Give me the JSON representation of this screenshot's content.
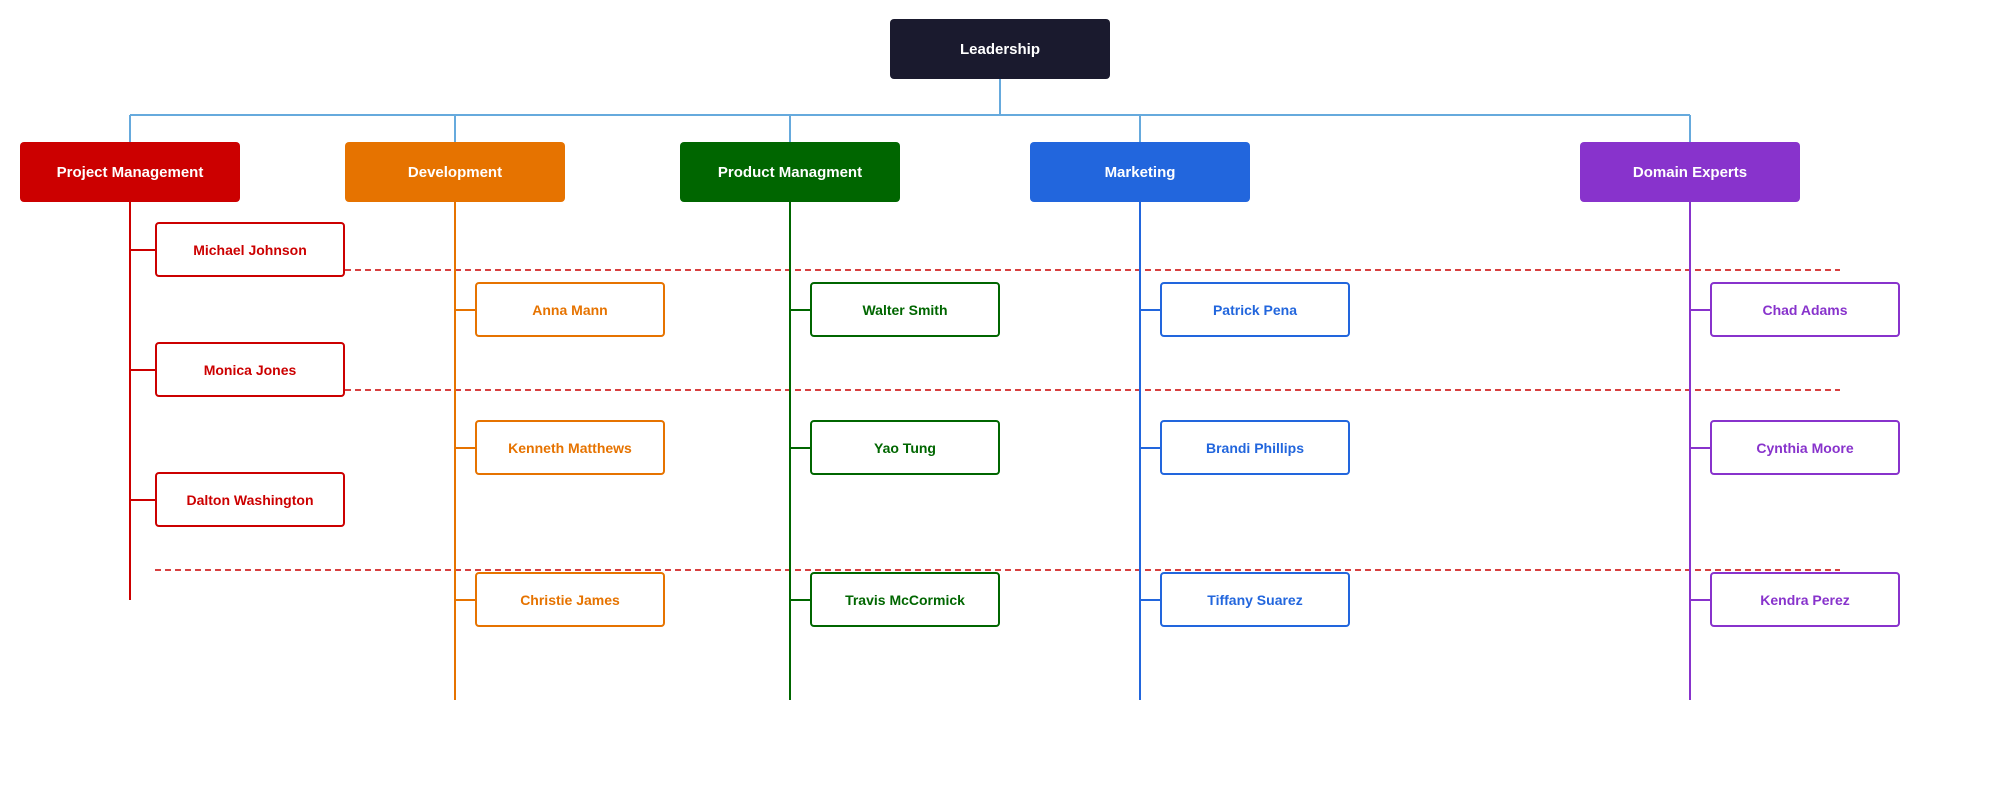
{
  "chart": {
    "title": "Leadership",
    "departments": [
      {
        "id": "pm",
        "label": "Project Management",
        "color": "#cc0000",
        "style": "red"
      },
      {
        "id": "dev",
        "label": "Development",
        "color": "#e67300",
        "style": "orange"
      },
      {
        "id": "prodmgmt",
        "label": "Product Managment",
        "color": "#006600",
        "style": "green"
      },
      {
        "id": "marketing",
        "label": "Marketing",
        "color": "#2266dd",
        "style": "blue"
      },
      {
        "id": "domain",
        "label": "Domain Experts",
        "color": "#8833cc",
        "style": "purple"
      }
    ],
    "persons": {
      "pm": [
        "Michael Johnson",
        "Monica Jones",
        "Dalton Washington"
      ],
      "dev": [
        "Anna Mann",
        "Kenneth Matthews",
        "Christie James"
      ],
      "prodmgmt": [
        "Walter Smith",
        "Yao Tung",
        "Travis McCormick"
      ],
      "marketing": [
        "Patrick Pena",
        "Brandi Phillips",
        "Tiffany Suarez"
      ],
      "domain": [
        "Chad Adams",
        "Cynthia Moore",
        "Kendra Perez"
      ]
    }
  }
}
